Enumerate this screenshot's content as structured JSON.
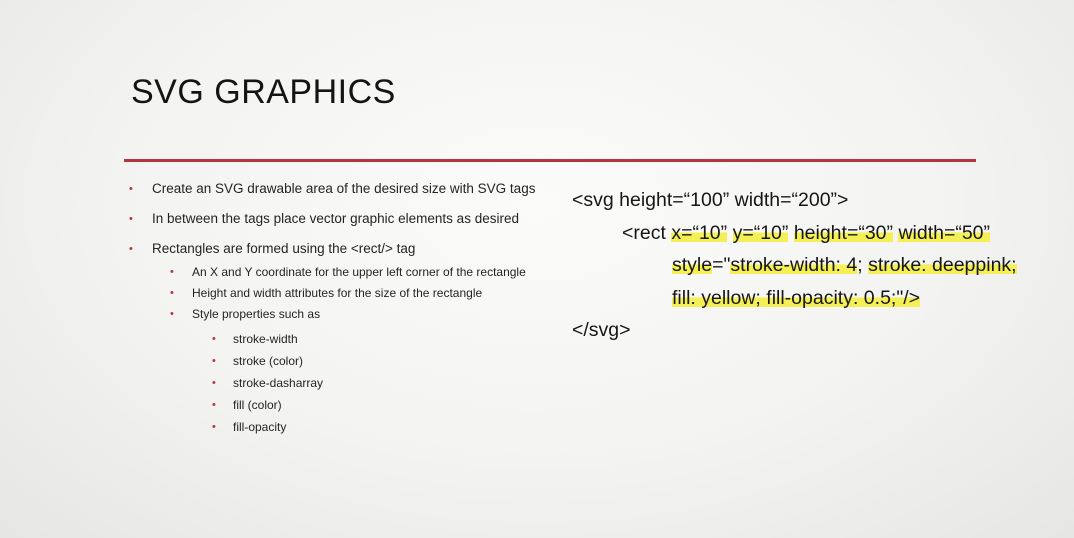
{
  "title": "SVG GRAPHICS",
  "colors": {
    "accent": "#b5343d",
    "highlight": "#f3ef55"
  },
  "bullets": [
    {
      "level": 1,
      "text": "Create an SVG drawable area of the desired size with SVG tags"
    },
    {
      "level": 1,
      "text": "In between the tags place vector graphic elements as desired"
    },
    {
      "level": 1,
      "text": "Rectangles are formed using the <rect/> tag"
    },
    {
      "level": 2,
      "text": "An X and Y coordinate for the upper left corner of the rectangle"
    },
    {
      "level": 2,
      "text": "Height and width attributes for the size of the rectangle"
    },
    {
      "level": 2,
      "text": "Style properties such as"
    },
    {
      "level": 3,
      "text": "stroke-width"
    },
    {
      "level": 3,
      "text": "stroke (color)"
    },
    {
      "level": 3,
      "text": "stroke-dasharray"
    },
    {
      "level": 3,
      "text": "fill (color)"
    },
    {
      "level": 3,
      "text": "fill-opacity"
    }
  ],
  "code": {
    "line1": "<svg height=“100” width=“200”>",
    "line2_prefix": "<rect ",
    "line2_x": "x=“10”",
    "line2_y": "y=“10”",
    "line2_height": "height=“30”",
    "line2_width": "width=“50”",
    "line3_style": "style",
    "line3_eq": "=\"",
    "line3_sw": "stroke-width: 4",
    "line3_sep1": "; ",
    "line3_stroke": "stroke: deeppink;",
    "line4_fill": "fill: yellow; fill-opacity: 0.5;\"/>",
    "line5": "</svg>"
  }
}
